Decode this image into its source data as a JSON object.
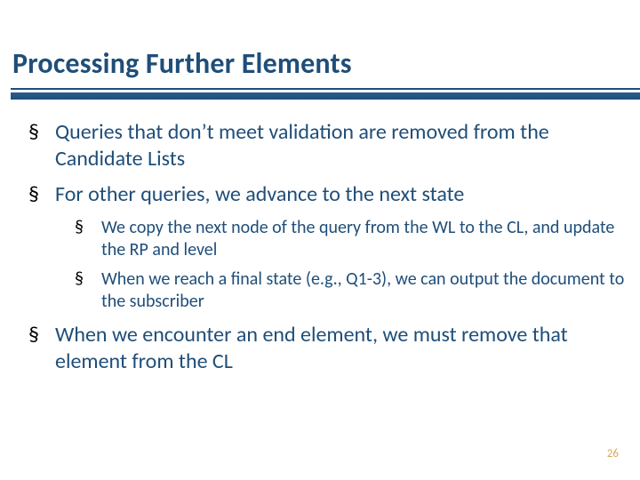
{
  "title": "Processing Further Elements",
  "bullets": {
    "b1": "Queries that don’t meet validation are removed from the Candidate Lists",
    "b2": "For other queries, we advance to the next state",
    "b2_sub": {
      "s1": "We copy the next node of the query from the WL to the CL, and update the RP and level",
      "s2": "When we reach a final state (e.g., Q1-3), we can output the document to the subscriber"
    },
    "b3": "When we encounter an end element, we must remove that element from the CL"
  },
  "page_number": "26"
}
